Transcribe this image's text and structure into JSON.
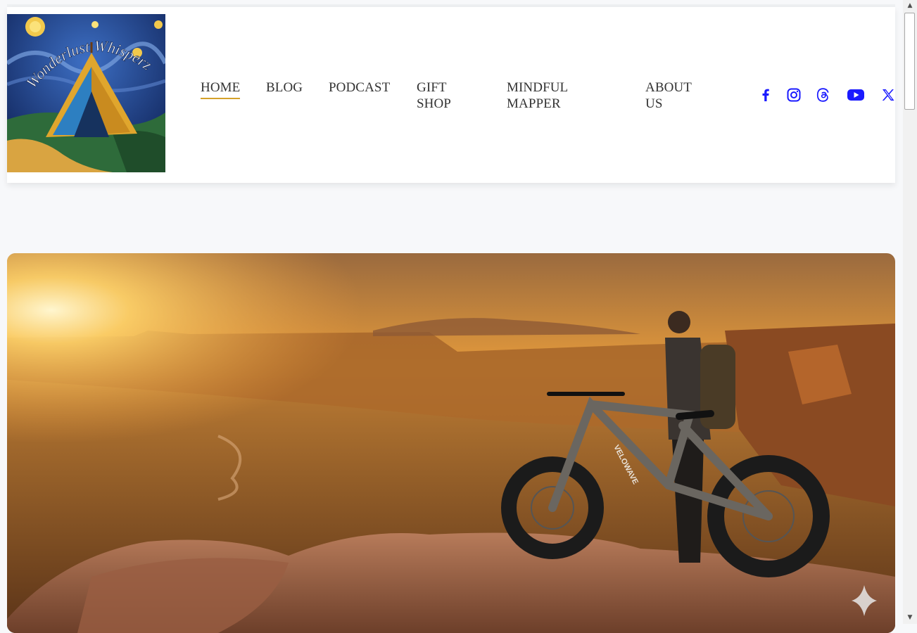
{
  "site": {
    "logo_text": "Wonderlust Whisperz"
  },
  "nav": {
    "items": [
      {
        "label": "HOME",
        "active": true
      },
      {
        "label": "BLOG",
        "active": false
      },
      {
        "label": "PODCAST",
        "active": false
      },
      {
        "label": "GIFT SHOP",
        "active": false
      },
      {
        "label": "MINDFUL MAPPER",
        "active": false
      },
      {
        "label": "ABOUT US",
        "active": false
      }
    ]
  },
  "social": {
    "color": "#1a1aff",
    "icons": [
      "facebook-icon",
      "instagram-icon",
      "threads-icon",
      "youtube-icon",
      "x-twitter-icon"
    ]
  },
  "hero": {
    "bike_brand": "VELOWAVE",
    "accent": "#d4a12a"
  },
  "colors": {
    "nav_text": "#333333",
    "active_underline": "#d4a12a",
    "page_bg": "#f7f8fa"
  }
}
